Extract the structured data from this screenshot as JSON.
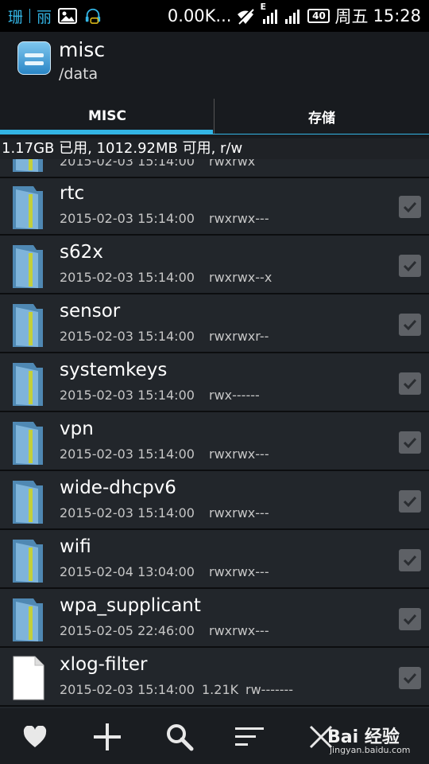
{
  "status_bar": {
    "notify_text_1": "珊",
    "notify_text_2": "丽",
    "speed": "0.00K...",
    "network_type": "E",
    "battery_level": "40",
    "day": "周五",
    "time": "15:28"
  },
  "action_bar": {
    "title": "misc",
    "subtitle": "/data"
  },
  "tabs": [
    {
      "label": "MISC",
      "selected": true
    },
    {
      "label": "存储",
      "selected": false
    }
  ],
  "storage_info": "1.17GB 已用, 1012.92MB 可用, r/w",
  "partial_row": {
    "date": "2015-02-03 15:14:00",
    "perm": "rwxrwx"
  },
  "files": [
    {
      "name": "rtc",
      "date": "2015-02-03 15:14:00",
      "size": "",
      "perm": "rwxrwx---",
      "type": "folder"
    },
    {
      "name": "s62x",
      "date": "2015-02-03 15:14:00",
      "size": "",
      "perm": "rwxrwx--x",
      "type": "folder"
    },
    {
      "name": "sensor",
      "date": "2015-02-03 15:14:00",
      "size": "",
      "perm": "rwxrwxr--",
      "type": "folder"
    },
    {
      "name": "systemkeys",
      "date": "2015-02-03 15:14:00",
      "size": "",
      "perm": "rwx------",
      "type": "folder"
    },
    {
      "name": "vpn",
      "date": "2015-02-03 15:14:00",
      "size": "",
      "perm": "rwxrwx---",
      "type": "folder"
    },
    {
      "name": "wide-dhcpv6",
      "date": "2015-02-03 15:14:00",
      "size": "",
      "perm": "rwxrwx---",
      "type": "folder"
    },
    {
      "name": "wifi",
      "date": "2015-02-04 13:04:00",
      "size": "",
      "perm": "rwxrwx---",
      "type": "folder"
    },
    {
      "name": "wpa_supplicant",
      "date": "2015-02-05 22:46:00",
      "size": "",
      "perm": "rwxrwx---",
      "type": "folder"
    },
    {
      "name": "xlog-filter",
      "date": "2015-02-03 15:14:00",
      "size": "1.21K",
      "perm": "rw-------",
      "type": "file"
    }
  ],
  "bottom_bar": {
    "icons": [
      "heart-icon",
      "plus-icon",
      "search-icon",
      "sort-icon",
      "close-icon"
    ],
    "watermark": "Bai 经验",
    "watermark_sub": "jingyan.baidu.com"
  }
}
